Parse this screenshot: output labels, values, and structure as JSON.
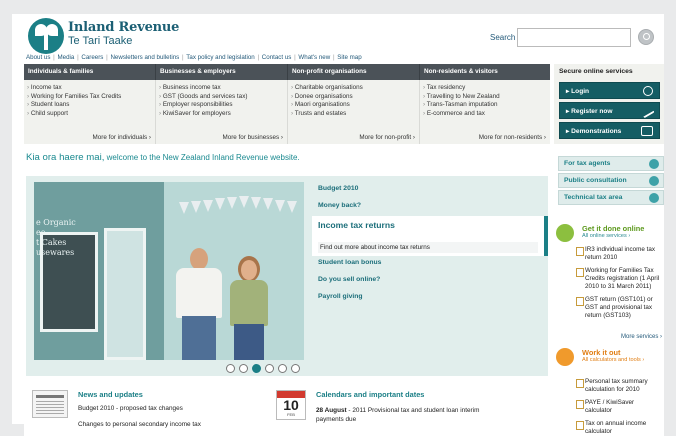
{
  "header": {
    "brand_name": "Inland Revenue",
    "brand_maori": "Te Tari Taake",
    "search_label": "Search",
    "search_value": "",
    "top_links": [
      "About us",
      "Media",
      "Careers",
      "Newsletters and bulletins",
      "Tax policy and legislation",
      "Contact us",
      "What's new",
      "Site map"
    ]
  },
  "nav": {
    "categories": [
      {
        "title": "Individuals & families",
        "items": [
          "Income tax",
          "Working for Families Tax Credits",
          "Student loans",
          "Child support"
        ],
        "more": "More for individuals ›"
      },
      {
        "title": "Businesses & employers",
        "items": [
          "Business income tax",
          "GST (Goods and services tax)",
          "Employer responsibilities",
          "KiwiSaver for employers"
        ],
        "more": "More for businesses ›"
      },
      {
        "title": "Non-profit organisations",
        "items": [
          "Charitable organisations",
          "Donee organisations",
          "Maori organisations",
          "Trusts and estates"
        ],
        "more": "More for non-profit ›"
      },
      {
        "title": "Non-residents & visitors",
        "items": [
          "Tax residency",
          "Travelling to New Zealand",
          "Trans-Tasman imputation",
          "E-commerce and tax"
        ],
        "more": "More for non-residents ›"
      }
    ]
  },
  "secure": {
    "title": "Secure online services",
    "login": "▸ Login",
    "register": "▸ Register now",
    "demos": "▸ Demonstrations"
  },
  "welcome": {
    "greeting": "Kia ora haere mai,",
    "rest": " welcome to the New Zealand Inland Revenue website."
  },
  "right_links": [
    "For tax agents",
    "Public consultation",
    "Technical tax area"
  ],
  "hero": {
    "photo_sign": "e Organic\nee\nt Cakes\nusewares",
    "features": [
      "Budget 2010",
      "Money back?",
      "Income tax returns",
      "Student loan bonus",
      "Do you sell online?",
      "Payroll giving"
    ],
    "active_title": "Income tax returns",
    "active_sub": "Find out more about income tax returns",
    "slide_count": 6,
    "active_slide": 3
  },
  "get_it_done": {
    "title": "Get it done online",
    "sub": "All online services ›",
    "items": [
      "IR3 individual income tax return 2010",
      "Working for Families Tax Credits registration (1 April 2010 to 31 March 2011)",
      "GST return (GST101) or GST and provisional tax return (GST103)"
    ],
    "more": "More services ›"
  },
  "work_it_out": {
    "title": "Work it out",
    "sub": "All calculators and tools ›",
    "items": [
      "Personal tax summary calculation for 2010",
      "PAYE / KiwiSaver calculator",
      "Tax on annual income calculator"
    ]
  },
  "news": {
    "title": "News and updates",
    "items": [
      "Budget 2010 - proposed tax changes",
      "Changes to personal secondary income tax"
    ]
  },
  "calendar": {
    "title": "Calendars and important dates",
    "date_num": "10",
    "month": "FEB",
    "date_bold": "28 August",
    "date_text": " - 2011 Provisional tax and student loan interim payments due"
  },
  "colors": {
    "brand": "#1b7f86",
    "nav": "#4b5258",
    "secure_btn": "#155d64"
  }
}
